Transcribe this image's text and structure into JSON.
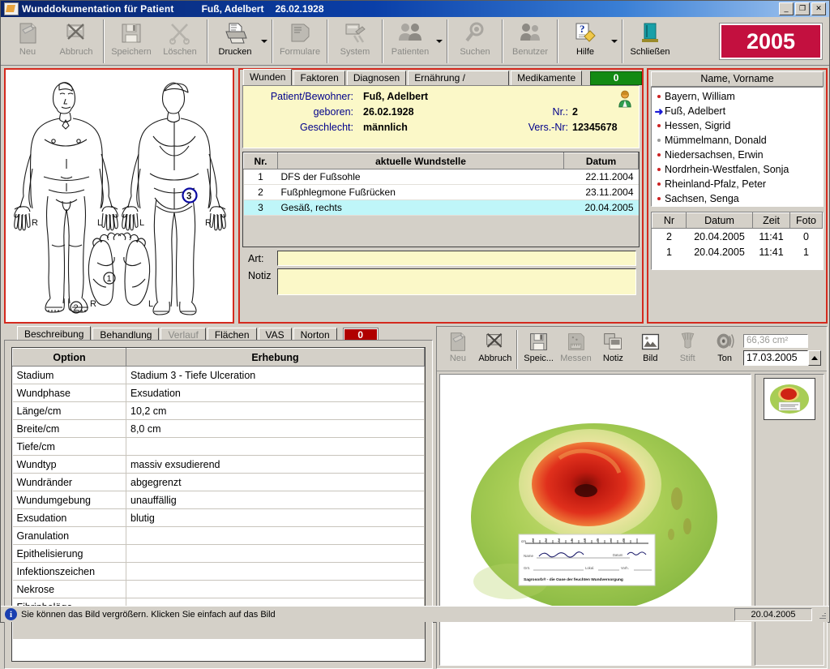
{
  "window": {
    "title": "Wunddokumentation für Patient",
    "patient": "Fuß, Adelbert",
    "dob": "26.02.1928",
    "minimize": "_",
    "maximize": "❐",
    "close": "✕"
  },
  "toolbar": {
    "buttons": [
      {
        "label": "Neu",
        "icon": "new-document-icon",
        "enabled": false,
        "dropdown": false
      },
      {
        "label": "Abbruch",
        "icon": "cancel-icon",
        "enabled": false,
        "dropdown": false
      },
      {
        "label": "Speichern",
        "icon": "save-disk-icon",
        "enabled": false,
        "dropdown": false
      },
      {
        "label": "Löschen",
        "icon": "delete-scissors-icon",
        "enabled": false,
        "dropdown": false
      },
      {
        "label": "Drucken",
        "icon": "printer-icon",
        "enabled": true,
        "dropdown": true
      },
      {
        "label": "Formulare",
        "icon": "forms-icon",
        "enabled": false,
        "dropdown": false
      },
      {
        "label": "System",
        "icon": "system-tools-icon",
        "enabled": false,
        "dropdown": false
      },
      {
        "label": "Patienten",
        "icon": "patients-people-icon",
        "enabled": false,
        "dropdown": true
      },
      {
        "label": "Suchen",
        "icon": "search-magnifier-icon",
        "enabled": false,
        "dropdown": false
      },
      {
        "label": "Benutzer",
        "icon": "user-people-icon",
        "enabled": false,
        "dropdown": false
      },
      {
        "label": "Hilfe",
        "icon": "help-question-icon",
        "enabled": true,
        "dropdown": true
      },
      {
        "label": "Schließen",
        "icon": "exit-door-icon",
        "enabled": true,
        "dropdown": false
      }
    ],
    "year": "2005",
    "year_color": "#c3103f"
  },
  "body_diagram": {
    "markers": [
      {
        "id": "1",
        "location": "Fußsohle rechts"
      },
      {
        "id": "2",
        "location": "Fußrücken rechts"
      },
      {
        "id": "3",
        "location": "Gesäß rechts"
      }
    ],
    "side_labels": [
      "R",
      "L",
      "L",
      "R",
      "R",
      "L"
    ],
    "marker_color": "#0a0aa0"
  },
  "center": {
    "tabs": [
      {
        "label": "Wunden",
        "active": true
      },
      {
        "label": "Faktoren",
        "active": false
      },
      {
        "label": "Diagnosen",
        "active": false
      },
      {
        "label": "Ernährung / Situation",
        "active": false
      },
      {
        "label": "Medikamente",
        "active": false
      }
    ],
    "badge": {
      "value": "0",
      "color": "#138a13"
    },
    "patient_info": {
      "label_name": "Patient/Bewohner:",
      "value_name": "Fuß, Adelbert",
      "label_born": "geboren:",
      "value_born": "26.02.1928",
      "label_sex": "Geschlecht:",
      "value_sex": "männlich",
      "label_nr": "Nr.:",
      "value_nr": "2",
      "label_vers": "Vers.-Nr:",
      "value_vers": "12345678"
    },
    "wound_table": {
      "headers": [
        "Nr.",
        "aktuelle Wundstelle",
        "Datum"
      ],
      "rows": [
        {
          "nr": "1",
          "site": "DFS der Fußsohle",
          "date": "22.11.2004",
          "selected": false
        },
        {
          "nr": "2",
          "site": "Fußphlegmone Fußrücken",
          "date": "23.11.2004",
          "selected": false
        },
        {
          "nr": "3",
          "site": "Gesäß, rechts",
          "date": "20.04.2005",
          "selected": true
        }
      ]
    },
    "art_label": "Art:",
    "art_value": "",
    "notiz_label": "Notiz",
    "notiz_value": ""
  },
  "right_panel": {
    "names_header": "Name, Vorname",
    "names": [
      {
        "label": "Bayern, William",
        "marker": "dot",
        "selected": false
      },
      {
        "label": "Fuß, Adelbert",
        "marker": "arrow",
        "selected": true
      },
      {
        "label": "Hessen, Sigrid",
        "marker": "dot",
        "selected": false
      },
      {
        "label": "Mümmelmann, Donald",
        "marker": "dot-grey",
        "selected": false
      },
      {
        "label": "Niedersachsen, Erwin",
        "marker": "dot",
        "selected": false
      },
      {
        "label": "Nordrhein-Westfalen, Sonja",
        "marker": "dot",
        "selected": false
      },
      {
        "label": "Rheinland-Pfalz, Peter",
        "marker": "dot",
        "selected": false
      },
      {
        "label": "Sachsen, Senga",
        "marker": "dot",
        "selected": false
      }
    ],
    "session_table": {
      "headers": [
        "Nr",
        "Datum",
        "Zeit",
        "Foto"
      ],
      "rows": [
        {
          "marker": "",
          "nr": "2",
          "date": "20.04.2005",
          "time": "11:41",
          "photo": "0"
        },
        {
          "marker": "arrow",
          "nr": "1",
          "date": "20.04.2005",
          "time": "11:41",
          "photo": "1"
        }
      ]
    }
  },
  "bottom_tabs": [
    {
      "label": "Beschreibung",
      "active": true,
      "disabled": false
    },
    {
      "label": "Behandlung",
      "active": false,
      "disabled": false
    },
    {
      "label": "Verlauf",
      "active": false,
      "disabled": true
    },
    {
      "label": "Flächen",
      "active": false,
      "disabled": false
    },
    {
      "label": "VAS",
      "active": false,
      "disabled": false
    },
    {
      "label": "Norton",
      "active": false,
      "disabled": false
    }
  ],
  "bottom_badge": {
    "value": "0",
    "color": "#b00000"
  },
  "option_table": {
    "headers": [
      "Option",
      "Erhebung"
    ],
    "rows": [
      {
        "option": "Stadium",
        "value": "Stadium 3 - Tiefe Ulceration"
      },
      {
        "option": "Wundphase",
        "value": "Exsudation"
      },
      {
        "option": "Länge/cm",
        "value": "10,2 cm"
      },
      {
        "option": "Breite/cm",
        "value": "8,0 cm"
      },
      {
        "option": "Tiefe/cm",
        "value": ""
      },
      {
        "option": "Wundtyp",
        "value": "massiv exsudierend"
      },
      {
        "option": "Wundränder",
        "value": "abgegrenzt"
      },
      {
        "option": "Wundumgebung",
        "value": "unauffällig"
      },
      {
        "option": "Exsudation",
        "value": "blutig"
      },
      {
        "option": "Granulation",
        "value": ""
      },
      {
        "option": "Epithelisierung",
        "value": ""
      },
      {
        "option": "Infektionszeichen",
        "value": ""
      },
      {
        "option": "Nekrose",
        "value": ""
      },
      {
        "option": "Fibrinbeläge",
        "value": ""
      }
    ]
  },
  "photo_panel": {
    "buttons": [
      {
        "label": "Neu",
        "icon": "new-document-icon",
        "enabled": false
      },
      {
        "label": "Abbruch",
        "icon": "cancel-icon",
        "enabled": true
      },
      {
        "label": "Speic...",
        "icon": "save-disk-icon",
        "enabled": true
      },
      {
        "label": "Messen",
        "icon": "measure-icon",
        "enabled": false
      },
      {
        "label": "Notiz",
        "icon": "note-icon",
        "enabled": true
      },
      {
        "label": "Bild",
        "icon": "picture-icon",
        "enabled": true
      },
      {
        "label": "Stift",
        "icon": "pen-icon",
        "enabled": false
      },
      {
        "label": "Ton",
        "icon": "sound-icon",
        "enabled": true
      }
    ],
    "area_value": "66,36 cm²",
    "date_value": "17.03.2005",
    "photo_alt": "wound-photograph",
    "ruler_label": "Sagrosorb® - die Oase der feuchten Wundversorgung"
  },
  "statusbar": {
    "icon": "info-icon",
    "message": "Sie können das Bild vergrößern. Klicken Sie einfach auf das Bild",
    "date": "20.04.2005"
  }
}
